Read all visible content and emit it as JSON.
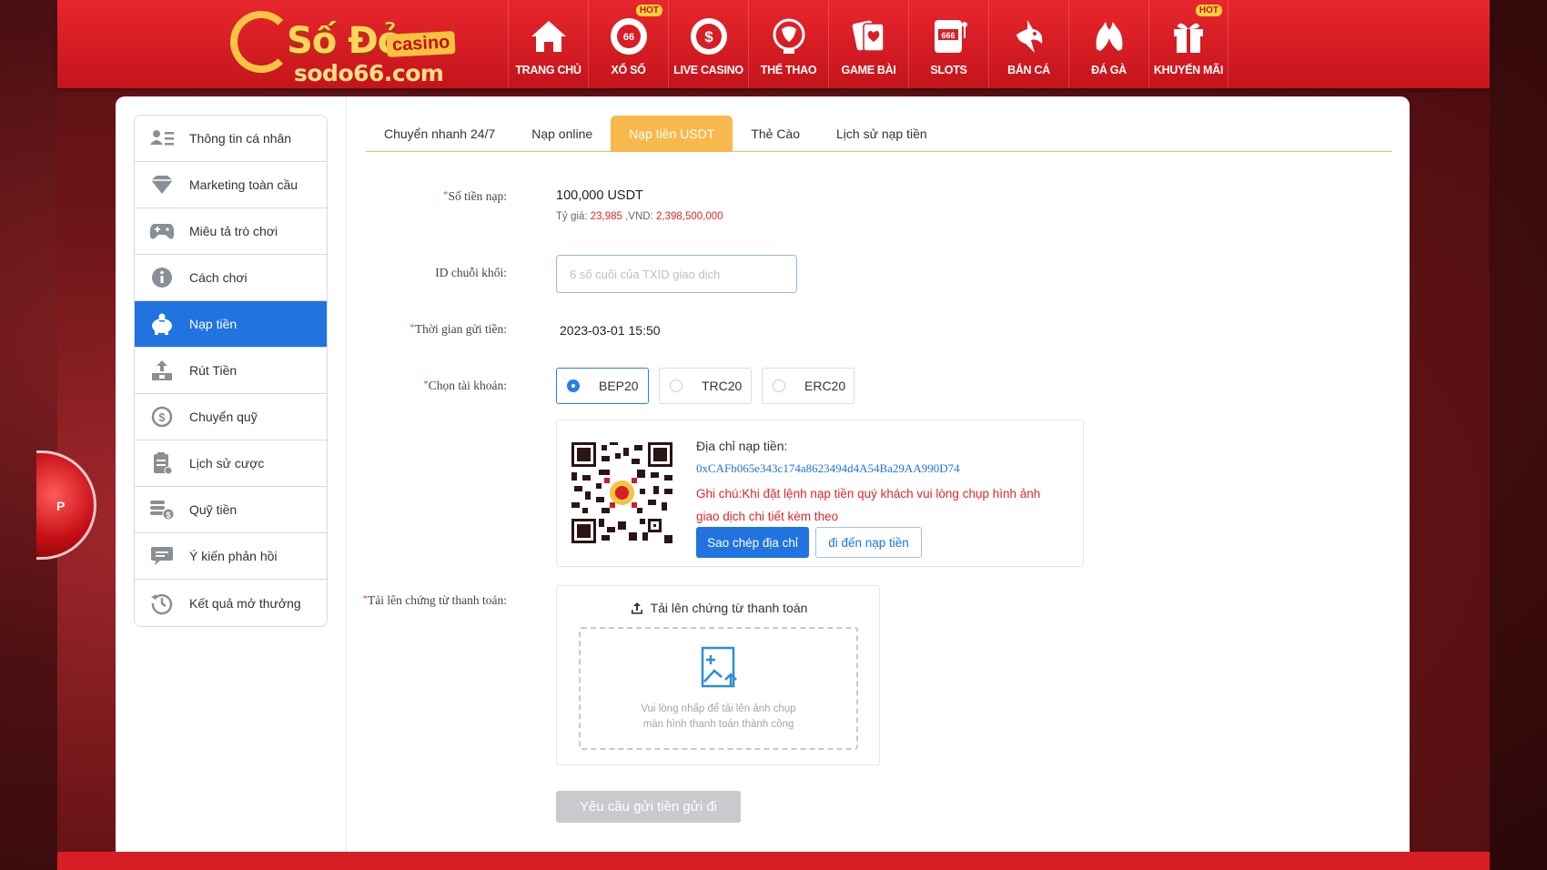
{
  "brand": {
    "title": "Số Đỏ",
    "badge": "casino",
    "domain": "sodo66.com"
  },
  "nav": [
    {
      "label": "TRANG CHỦ",
      "icon": "home-icon",
      "hot": ""
    },
    {
      "label": "XỔ SỐ",
      "icon": "lottery-icon",
      "hot": "HOT",
      "icon_text": "66"
    },
    {
      "label": "LIVE CASINO",
      "icon": "casino-chip-icon",
      "hot": ""
    },
    {
      "label": "THỂ THAO",
      "icon": "trophy-icon",
      "hot": ""
    },
    {
      "label": "GAME BÀI",
      "icon": "playing-cards-icon",
      "hot": ""
    },
    {
      "label": "SLOTS",
      "icon": "slot-machine-icon",
      "hot": "",
      "icon_text": "666"
    },
    {
      "label": "BẮN CÁ",
      "icon": "shark-icon",
      "hot": ""
    },
    {
      "label": "ĐÁ GÀ",
      "icon": "rooster-icon",
      "hot": ""
    },
    {
      "label": "KHUYẾN MÃI",
      "icon": "gift-icon",
      "hot": "HOT"
    }
  ],
  "sidebar": {
    "items": [
      {
        "label": "Thông tin cá nhân",
        "icon": "user-list-icon",
        "active": false
      },
      {
        "label": "Marketing toàn cầu",
        "icon": "diamond-icon",
        "active": false
      },
      {
        "label": "Miêu tả trò chơi",
        "icon": "gamepad-icon",
        "active": false
      },
      {
        "label": "Cách chơi",
        "icon": "info-icon",
        "active": false
      },
      {
        "label": "Nạp tiền",
        "icon": "piggy-bank-icon",
        "active": true
      },
      {
        "label": "Rút Tiền",
        "icon": "withdraw-icon",
        "active": false
      },
      {
        "label": "Chuyển quỹ",
        "icon": "dollar-circle-icon",
        "active": false
      },
      {
        "label": "Lịch sử cược",
        "icon": "clipboard-icon",
        "active": false
      },
      {
        "label": "Quỹ tiền",
        "icon": "coins-icon",
        "active": false
      },
      {
        "label": "Ý kiến phản hồi",
        "icon": "chat-icon",
        "active": false
      },
      {
        "label": "Kết quả mở thưởng",
        "icon": "history-icon",
        "active": false
      }
    ]
  },
  "tabs": [
    {
      "label": "Chuyển nhanh 24/7",
      "active": false
    },
    {
      "label": "Nạp online",
      "active": false
    },
    {
      "label": "Nạp tiền USDT",
      "active": true
    },
    {
      "label": "Thẻ Cào",
      "active": false
    },
    {
      "label": "Lịch sử nạp tiền",
      "active": false
    }
  ],
  "form": {
    "amount_label": "Số tiền nạp:",
    "amount_value": "100,000 USDT",
    "rate_prefix": "Tỷ giá: ",
    "rate_value": "23,985",
    "vnd_prefix": " ,VND: ",
    "vnd_value": "2,398,500,000",
    "txid_label": "ID chuỗi khối:",
    "txid_placeholder": "6 số cuối của TXID giao dịch",
    "txid_value": "",
    "time_label": "Thời gian gửi tiền:",
    "time_value": "2023-03-01 15:50",
    "account_label": "Chọn tài khoản:",
    "networks": [
      {
        "label": "BEP20",
        "selected": true
      },
      {
        "label": "TRC20",
        "selected": false
      },
      {
        "label": "ERC20",
        "selected": false
      }
    ],
    "address_label": "Địa chỉ nạp tiền:",
    "address_value": "0xCAFb065e343c174a8623494d4A54Ba29AA990D74",
    "note": "Ghi chú:Khi đặt lệnh nạp tiền quý khách vui lòng chụp hình ảnh giao dịch chi tiết kèm theo",
    "copy_button": "Sao chép địa chỉ",
    "goto_button": "đi đến nạp tiền",
    "upload_label": "Tải lên chứng từ thanh toán:",
    "upload_title": "Tải lên chứng từ thanh toán",
    "upload_hint_line1": "Vui lòng nhấp để tải lên ảnh chụp",
    "upload_hint_line2": "màn hình thanh toán thành công",
    "submit_button": "Yêu cầu gửi tiền gửi đi"
  },
  "side_decoration": "P",
  "colors": {
    "header_red": "#d81e25",
    "accent_blue": "#2173e0",
    "tab_orange": "#f7b94c",
    "note_red": "#e02828"
  }
}
